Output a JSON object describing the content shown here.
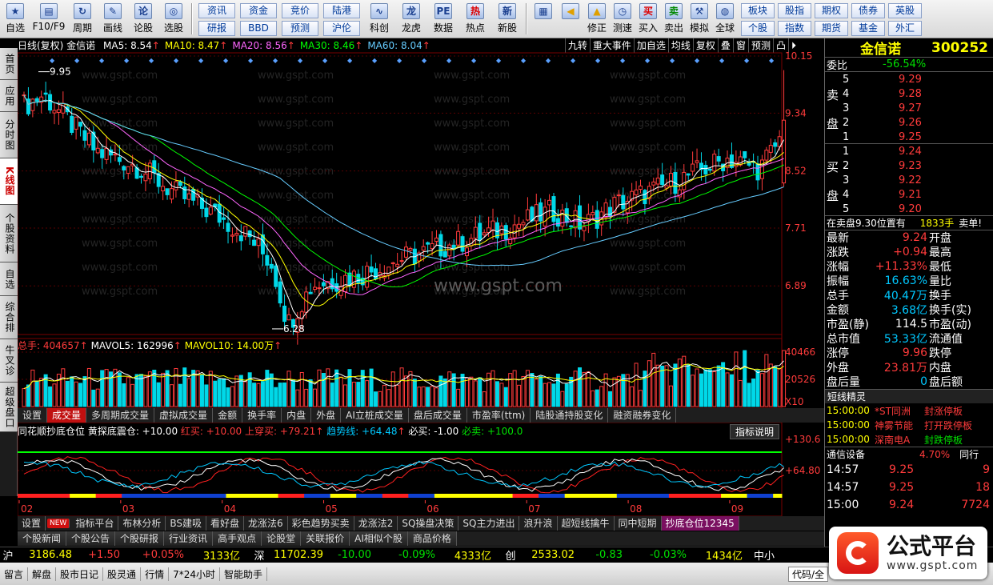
{
  "toolbar": {
    "buttons": [
      {
        "icon": "star-icon",
        "label": "自选"
      },
      {
        "icon": "f10-icon",
        "label": "F10/F9"
      },
      {
        "icon": "cycle-icon",
        "label": "周期"
      },
      {
        "icon": "pen-icon",
        "label": "画线"
      },
      {
        "icon": "review-icon",
        "label": "论股"
      },
      {
        "icon": "select-icon",
        "label": "选股"
      }
    ],
    "grid1": [
      "资讯",
      "资金",
      "竞价",
      "陆港",
      "研报",
      "BBD",
      "预测",
      "沪伦"
    ],
    "buttons2": [
      {
        "icon": "chart-icon",
        "label": "科创"
      },
      {
        "icon": "dragon-icon",
        "label": "龙虎"
      },
      {
        "icon": "pe-icon",
        "label": "数据"
      },
      {
        "icon": "hot-icon",
        "label": "热点"
      },
      {
        "icon": "ipo-icon",
        "label": "新股"
      }
    ],
    "buttons3": [
      {
        "icon": "color-grid-icon",
        "label": ""
      },
      {
        "icon": "arrow-left-icon",
        "label": ""
      },
      {
        "icon": "arrow-up-icon",
        "label": "修正"
      },
      {
        "icon": "clock-icon",
        "label": "测速"
      },
      {
        "icon": "buy-icon",
        "label": "买入"
      },
      {
        "icon": "sell-icon",
        "label": "卖出"
      },
      {
        "icon": "hammer-icon",
        "label": "模拟"
      },
      {
        "icon": "globe-icon",
        "label": "全球"
      }
    ],
    "grid2": [
      "板块",
      "股指",
      "期权",
      "债券",
      "英股",
      "个股",
      "指数",
      "期货",
      "基金",
      "外汇"
    ]
  },
  "left_tabs": [
    "首页",
    "应用",
    "分时图",
    "K线图",
    "个股资料",
    "自选股",
    "综合排名",
    "牛叉诊股",
    "超级盘口"
  ],
  "active_left_tab": "K线图",
  "main": {
    "title": "日线(复权) 金信诺",
    "ma": [
      {
        "label": "MA5: 8.54",
        "color": "#ffffff"
      },
      {
        "label": "MA10: 8.47",
        "color": "#ffff00"
      },
      {
        "label": "MA20: 8.56",
        "color": "#ff66ff"
      },
      {
        "label": "MA30: 8.46",
        "color": "#00ff00"
      },
      {
        "label": "MA60: 8.04",
        "color": "#66ccff"
      }
    ],
    "tools": [
      "九转",
      "重大事件",
      "加自选",
      "均线",
      "复权",
      "叠",
      "窗",
      "预测",
      "凸",
      "⏵"
    ],
    "price_ticks": [
      "10.15",
      "9.34",
      "8.52",
      "7.71",
      "6.89"
    ],
    "high_label": "9.95",
    "low_label": "6.28",
    "watermark": "www.gspt.com"
  },
  "volume": {
    "total_label": "总手: 404657",
    "mavol5": "MAVOL5: 162996",
    "mavol10": "MAVOL10: 14.00万",
    "ticks": [
      "40466",
      "20526",
      "X10"
    ],
    "tabs": [
      "设置",
      "成交量",
      "多周期成交量",
      "虚拟成交量",
      "金额",
      "换手率",
      "内盘",
      "外盘",
      "AI立桩成交量",
      "盘后成交量",
      "市盈率(ttm)",
      "陆股通持股变化",
      "融资融券变化"
    ],
    "active_tab": "成交量"
  },
  "indicator": {
    "title": "同花顺抄底仓位 黄探底震仓: +10.00",
    "red_buy": "红买: +10.00",
    "up_buy": "上穿买: +79.21",
    "trend": "趋势线: +64.48",
    "must_buy": "必买: -1.00",
    "must_sell": "必卖: +100.0",
    "explain": "指标说明",
    "ticks": [
      "+130.6",
      "+64.80"
    ],
    "months": [
      "02",
      "03",
      "04",
      "05",
      "06",
      "07",
      "08",
      "09"
    ]
  },
  "ind_tabs": [
    "设置",
    "NEW",
    "指标平台",
    "布林分析",
    "BS建吸",
    "看好盘",
    "龙涨法6",
    "彩色趋势买卖",
    "龙涨法2",
    "SQ操盘决策",
    "SQ主力进出",
    "浪升浪",
    "超短线擒牛",
    "同中短期",
    "抄底仓位12345"
  ],
  "news_tabs": [
    "个股新闻",
    "个股公告",
    "个股研报",
    "行业资讯",
    "高手观点",
    "论股堂",
    "关联报价",
    "AI相似个股",
    "商品价格"
  ],
  "index_bar": {
    "sh": [
      "沪",
      "3186.48",
      "+1.50",
      "+0.05%",
      "3133亿"
    ],
    "sz": [
      "深",
      "11702.39",
      "-10.00",
      "-0.09%",
      "4333亿"
    ],
    "cy": [
      "创",
      "2533.02",
      "-0.83",
      "-0.03%",
      "1434亿"
    ],
    "tail": "中小"
  },
  "status_bar": [
    "留言",
    "解盘",
    "股市日记",
    "股灵通",
    "行情",
    "7*24小时",
    "智能助手"
  ],
  "status_right": "代码/全",
  "panel": {
    "name": "金信诺",
    "code": "300252",
    "weibi_label": "委比",
    "weibi": "-56.54%",
    "sell_label": [
      "卖",
      "盘"
    ],
    "buy_label": [
      "买",
      "盘"
    ],
    "asks": [
      {
        "n": "5",
        "p": "9.29"
      },
      {
        "n": "4",
        "p": "9.28"
      },
      {
        "n": "3",
        "p": "9.27"
      },
      {
        "n": "2",
        "p": "9.26"
      },
      {
        "n": "1",
        "p": "9.25"
      }
    ],
    "bids": [
      {
        "n": "1",
        "p": "9.24"
      },
      {
        "n": "2",
        "p": "9.23"
      },
      {
        "n": "3",
        "p": "9.22"
      },
      {
        "n": "4",
        "p": "9.21"
      },
      {
        "n": "5",
        "p": "9.20"
      }
    ],
    "notice_a": "在卖盘9.30位置有",
    "notice_b": "1833手",
    "notice_c": "卖单!",
    "quote": [
      {
        "k1": "最新",
        "v1": "9.24",
        "c1": "red",
        "k2": "开盘",
        "v2": ""
      },
      {
        "k1": "涨跌",
        "v1": "+0.94",
        "c1": "red",
        "k2": "最高",
        "v2": ""
      },
      {
        "k1": "涨幅",
        "v1": "+11.33%",
        "c1": "red",
        "k2": "最低",
        "v2": ""
      },
      {
        "k1": "振幅",
        "v1": "16.63%",
        "c1": "cyan",
        "k2": "量比",
        "v2": ""
      },
      {
        "k1": "总手",
        "v1": "40.47万",
        "c1": "cyan",
        "k2": "换手",
        "v2": ""
      },
      {
        "k1": "金额",
        "v1": "3.68亿",
        "c1": "cyan",
        "k2": "换手(实)",
        "v2": ""
      },
      {
        "k1": "市盈(静)",
        "v1": "114.5",
        "c1": "white",
        "k2": "市盈(动)",
        "v2": ""
      },
      {
        "k1": "总市值",
        "v1": "53.33亿",
        "c1": "cyan",
        "k2": "流通值",
        "v2": ""
      },
      {
        "k1": "涨停",
        "v1": "9.96",
        "c1": "red",
        "k2": "跌停",
        "v2": ""
      },
      {
        "k1": "外盘",
        "v1": "23.81万",
        "c1": "red",
        "k2": "内盘",
        "v2": ""
      },
      {
        "k1": "盘后量",
        "v1": "0",
        "c1": "cyan",
        "k2": "盘后额",
        "v2": ""
      }
    ],
    "elf_title": "短线精灵",
    "elf": [
      {
        "t": "15:00:00",
        "s": "*ST同洲",
        "e": "封涨停板"
      },
      {
        "t": "15:00:00",
        "s": "神雾节能",
        "e": "打开跌停板"
      },
      {
        "t": "15:00:00",
        "s": "深南电A",
        "e": "封跌停板"
      }
    ],
    "sector": "通信设备",
    "sector_pct": "4.70%",
    "sector_tail": "同行",
    "ticks": [
      {
        "t": "14:57",
        "p": "9.25",
        "v": "9"
      },
      {
        "t": "14:57",
        "p": "9.25",
        "v": "18"
      },
      {
        "t": "15:00",
        "p": "9.24",
        "v": "7724"
      }
    ]
  },
  "logo": {
    "text": "公式平台",
    "url": "www.gspt.com"
  },
  "colors": {
    "up": "#ff3b3b",
    "down": "#00d8e8",
    "ma5": "#ffffff",
    "ma10": "#ffff00",
    "ma20": "#ff66ff",
    "ma30": "#00ff00",
    "ma60": "#66ccff"
  }
}
